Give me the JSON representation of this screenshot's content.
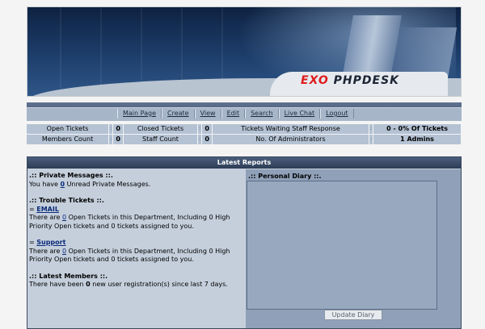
{
  "banner": {
    "logo_exo": "EXO",
    "logo_rest": "PHPDESK"
  },
  "nav": [
    {
      "label": "Main Page"
    },
    {
      "label": "Create"
    },
    {
      "label": "View"
    },
    {
      "label": "Edit"
    },
    {
      "label": "Search"
    },
    {
      "label": "Live Chat"
    },
    {
      "label": "Logout"
    }
  ],
  "stats": {
    "row1": [
      {
        "label": "Open Tickets",
        "value": "0"
      },
      {
        "label": "Closed Tickets",
        "value": "0"
      },
      {
        "label": "Tickets Waiting Staff Response",
        "value": "0 - 0% Of Tickets"
      }
    ],
    "row2": [
      {
        "label": "Members Count",
        "value": "0"
      },
      {
        "label": "Staff Count",
        "value": "0"
      },
      {
        "label": "No. Of Administrators",
        "value": "1 Admins"
      }
    ]
  },
  "panel": {
    "title": "Latest Reports",
    "private_messages": {
      "title": ".:: Private Messages ::.",
      "prefix": "You have ",
      "count": "0",
      "suffix": " Unread Private Messages."
    },
    "trouble_tickets": {
      "title": ".:: Trouble Tickets ::.",
      "departments": [
        {
          "bullet": "= ",
          "name": "EMAIL",
          "text_prefix": "There are ",
          "count": "0",
          "text_suffix": " Open Tickets in this Department, Including 0 High Priority Open tickets and 0 tickets assigned to you."
        },
        {
          "bullet": "= ",
          "name": "Support",
          "text_prefix": "There are ",
          "count": "0",
          "text_suffix": " Open Tickets in this Department, Including 0 High Priority Open tickets and 0 tickets assigned to you."
        }
      ]
    },
    "latest_members": {
      "title": ".:: Latest Members ::.",
      "prefix": "There have been ",
      "count": "0",
      "suffix": " new user registration(s) since last 7 days."
    },
    "diary": {
      "title": ".:: Personal Diary ::.",
      "value": "",
      "button": "Update Diary"
    }
  }
}
